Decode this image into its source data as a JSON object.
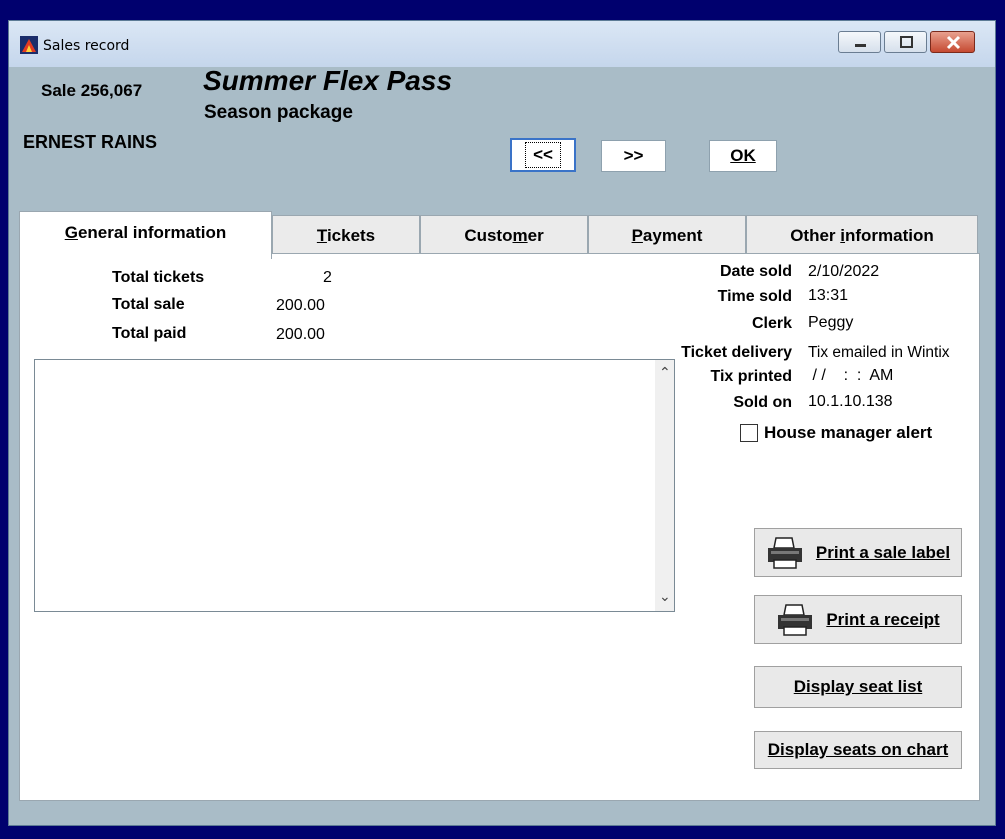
{
  "window": {
    "title": "Sales record"
  },
  "header": {
    "sale_number": "Sale 256,067",
    "event_title": "Summer Flex Pass",
    "event_subtitle": "Season package",
    "customer_name": "ERNEST RAINS"
  },
  "nav": {
    "prev_label": "<<",
    "next_label": ">>",
    "ok_label": "OK"
  },
  "tabs": [
    {
      "label": "General information",
      "underline": "G",
      "active": true
    },
    {
      "label": "Tickets",
      "underline": "T"
    },
    {
      "label": "Customer",
      "underline": "m"
    },
    {
      "label": "Payment",
      "underline": "P"
    },
    {
      "label": "Other information",
      "underline": "i"
    }
  ],
  "general": {
    "total_tickets_label": "Total tickets",
    "total_tickets": "2",
    "total_sale_label": "Total sale",
    "total_sale": "200.00",
    "total_paid_label": "Total paid",
    "total_paid": "200.00",
    "notes": ""
  },
  "details": {
    "date_sold_label": "Date sold",
    "date_sold": "2/10/2022",
    "time_sold_label": "Time sold",
    "time_sold": "13:31",
    "clerk_label": "Clerk",
    "clerk": "Peggy",
    "ticket_delivery_label": "Ticket delivery",
    "ticket_delivery": "Tix emailed in Wintix",
    "tix_printed_label": "Tix printed",
    "tix_printed": " / /    :  :  AM",
    "sold_on_label": "Sold on",
    "sold_on": "10.1.10.138",
    "house_alert_label": "House manager alert",
    "house_alert_checked": false
  },
  "actions": {
    "print_sale_label": "Print a sale label",
    "print_receipt": "Print a receipt",
    "display_seat_list": "Display seat list",
    "display_seats_chart": "Display seats on chart"
  },
  "colors": {
    "desktop": "#00006e",
    "window_bg": "#a9bcc7",
    "panel_bg": "#ffffff",
    "focus_border": "#3a73c8"
  }
}
